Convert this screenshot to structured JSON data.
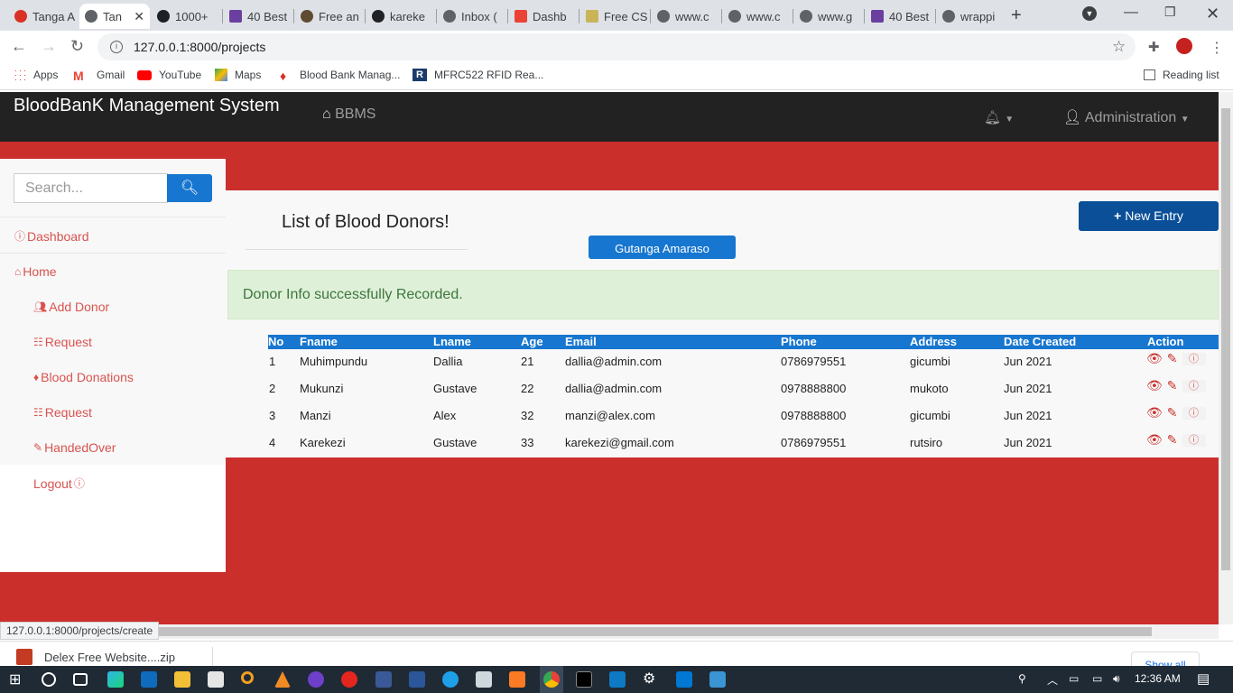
{
  "browser": {
    "tabs": [
      {
        "label": "Tanga A",
        "color": "#d93025"
      },
      {
        "label": "Tan",
        "color": "#5f6368"
      },
      {
        "label": "1000+",
        "color": "#202124"
      },
      {
        "label": "40 Best",
        "color": "#6b3fa0"
      },
      {
        "label": "Free an",
        "color": "#5f4b32"
      },
      {
        "label": "kareke",
        "color": "#202124"
      },
      {
        "label": "Inbox (",
        "color": "#5f6368"
      },
      {
        "label": "Dashb",
        "color": "#ea4335"
      },
      {
        "label": "Free CS",
        "color": "#c9b458"
      },
      {
        "label": "www.c",
        "color": "#5f6368"
      },
      {
        "label": "www.c",
        "color": "#5f6368"
      },
      {
        "label": "www.g",
        "color": "#5f6368"
      },
      {
        "label": "40 Best",
        "color": "#6b3fa0"
      },
      {
        "label": "wrappi",
        "color": "#5f6368"
      }
    ],
    "url": "127.0.0.1:8000/projects",
    "bookmarks": [
      {
        "label": "Apps"
      },
      {
        "label": "Gmail"
      },
      {
        "label": "YouTube"
      },
      {
        "label": "Maps"
      },
      {
        "label": "Blood Bank Manag..."
      },
      {
        "label": "MFRC522 RFID Rea..."
      }
    ],
    "reading_list": "Reading list",
    "status_url": "127.0.0.1:8000/projects/create"
  },
  "navbar": {
    "brand": "BloodBanK Management System",
    "home": "BBMS",
    "user": "Administration"
  },
  "sidebar": {
    "search_placeholder": "Search...",
    "items": [
      {
        "label": "Dashboard"
      },
      {
        "label": "Home"
      },
      {
        "label": "Add Donor"
      },
      {
        "label": "Request"
      },
      {
        "label": "Blood Donations"
      },
      {
        "label": "Request"
      },
      {
        "label": "HandedOver"
      },
      {
        "label": "Logout"
      }
    ]
  },
  "main": {
    "title": "List of Blood Donors!",
    "gutanga_button": "Gutanga Amaraso",
    "new_entry_button": "New Entry",
    "alert": "Donor Info successfully Recorded.",
    "columns": [
      "No",
      "Fname",
      "Lname",
      "Age",
      "Email",
      "Phone",
      "Address",
      "Date Created",
      "Action"
    ],
    "rows": [
      [
        "1",
        "Muhimpundu",
        "Dallia",
        "21",
        "dallia@admin.com",
        "0786979551",
        "gicumbi",
        "Jun 2021"
      ],
      [
        "2",
        "Mukunzi",
        "Gustave",
        "22",
        "dallia@admin.com",
        "0978888800",
        "mukoto",
        "Jun 2021"
      ],
      [
        "3",
        "Manzi",
        "Alex",
        "32",
        "manzi@alex.com",
        "0978888800",
        "gicumbi",
        "Jun 2021"
      ],
      [
        "4",
        "Karekezi",
        "Gustave",
        "33",
        "karekezi@gmail.com",
        "0786979551",
        "rutsiro",
        "Jun 2021"
      ]
    ]
  },
  "downloads": {
    "file": "Delex Free Website....zip",
    "show_all": "Show all"
  },
  "taskbar": {
    "time": "12:36 AM"
  },
  "colors": {
    "page_red": "#cb2f2c",
    "primary_blue": "#1776cf",
    "navbar": "#222222",
    "success_bg": "#dff0d8"
  }
}
